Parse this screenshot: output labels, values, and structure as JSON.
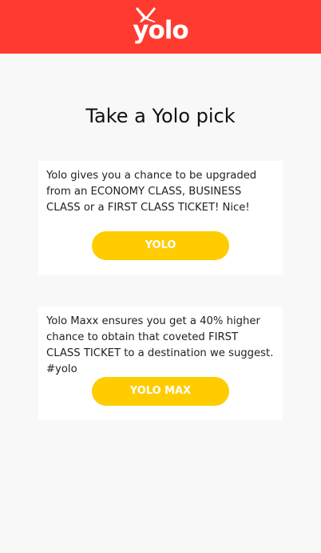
{
  "header": {
    "logo_text": "yolo",
    "background_color": "#ff3b30",
    "logo_icon": "airplane-icon"
  },
  "main": {
    "title": "Take a Yolo pick"
  },
  "cards": [
    {
      "description": "Yolo gives you a chance to be upgraded from an ECONOMY CLASS, BUSINESS CLASS or a FIRST CLASS TICKET! Nice!",
      "button_label": "YOLO"
    },
    {
      "description": "Yolo Maxx ensures you get a 40% higher chance to obtain that coveted FIRST CLASS TICKET to a destination we suggest. #yolo",
      "button_label": "YOLO MAX"
    }
  ],
  "colors": {
    "button": "#ffcc00",
    "page_background": "#f8f8f8"
  }
}
